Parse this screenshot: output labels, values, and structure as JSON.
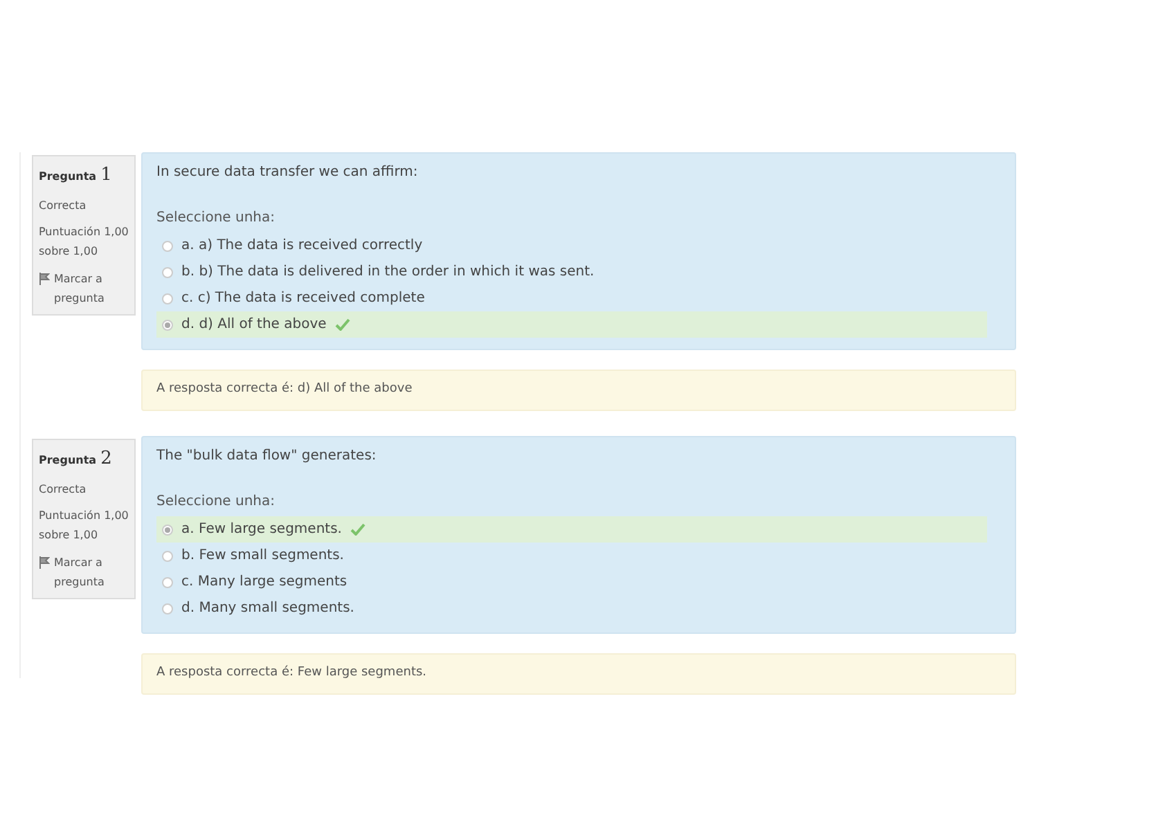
{
  "questions": [
    {
      "label": "Pregunta",
      "number": "1",
      "state": "Correcta",
      "score": "Puntuación 1,00 sobre 1,00",
      "flag": "Marcar a pregunta",
      "text": "In secure data transfer we can affirm:",
      "prompt": "Seleccione unha:",
      "options": [
        {
          "text": "a. a) The data is received correctly",
          "selected": false,
          "correct": false
        },
        {
          "text": "b. b) The data is delivered in the order in which it was sent.",
          "selected": false,
          "correct": false
        },
        {
          "text": "c. c) The data is received complete",
          "selected": false,
          "correct": false
        },
        {
          "text": "d. d) All of the above",
          "selected": true,
          "correct": true
        }
      ],
      "feedback": "A resposta correcta é: d) All of the above"
    },
    {
      "label": "Pregunta",
      "number": "2",
      "state": "Correcta",
      "score": "Puntuación 1,00 sobre 1,00",
      "flag": "Marcar a pregunta",
      "text": "The \"bulk data flow\" generates:",
      "prompt": "Seleccione unha:",
      "options": [
        {
          "text": "a. Few large segments.",
          "selected": true,
          "correct": true
        },
        {
          "text": "b. Few small segments.",
          "selected": false,
          "correct": false
        },
        {
          "text": "c. Many large segments",
          "selected": false,
          "correct": false
        },
        {
          "text": "d. Many small segments.",
          "selected": false,
          "correct": false
        }
      ],
      "feedback": "A resposta correcta é: Few large segments."
    }
  ]
}
